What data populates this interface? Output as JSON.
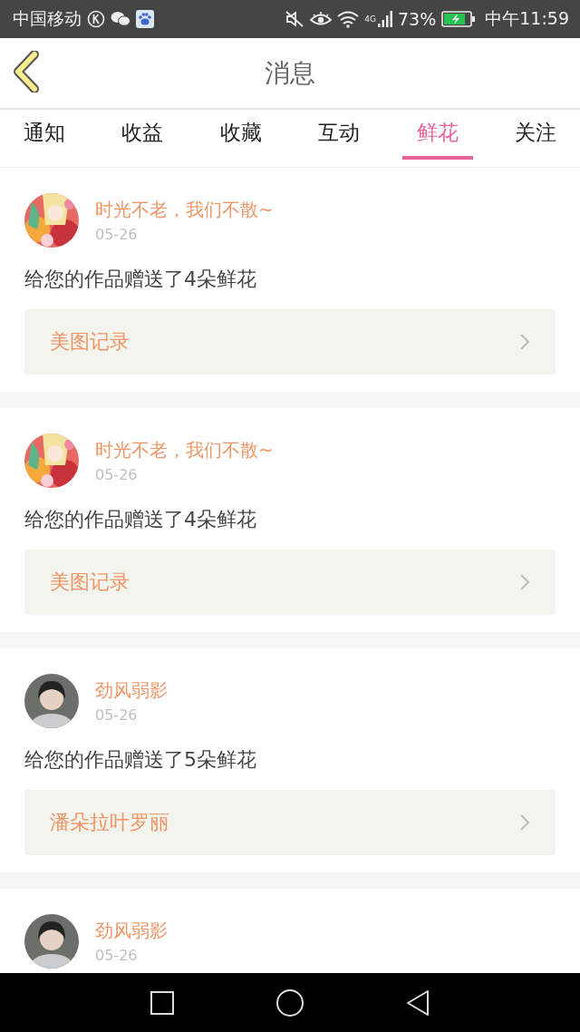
{
  "status_bar": {
    "carrier": "中国移动",
    "network": "4G",
    "battery": "73%",
    "time": "中午11:59"
  },
  "header": {
    "title": "消息"
  },
  "tabs": [
    {
      "label": "通知",
      "selected": false
    },
    {
      "label": "收益",
      "selected": false
    },
    {
      "label": "收藏",
      "selected": false
    },
    {
      "label": "互动",
      "selected": false
    },
    {
      "label": "鲜花",
      "selected": true
    },
    {
      "label": "关注",
      "selected": false
    }
  ],
  "messages": [
    {
      "kind": "picture",
      "name": "时光不老，我们不散~",
      "date": "05-26",
      "text": "给您的作品赠送了4朵鲜花",
      "link": "美图记录"
    },
    {
      "kind": "picture",
      "name": "时光不老，我们不散~",
      "date": "05-26",
      "text": "给您的作品赠送了4朵鲜花",
      "link": "美图记录"
    },
    {
      "kind": "silhouette",
      "name": "劲风弱影",
      "date": "05-26",
      "text": "给您的作品赠送了5朵鲜花",
      "link": "潘朵拉叶罗丽"
    },
    {
      "kind": "silhouette",
      "name": "劲风弱影",
      "date": "05-26"
    }
  ]
}
